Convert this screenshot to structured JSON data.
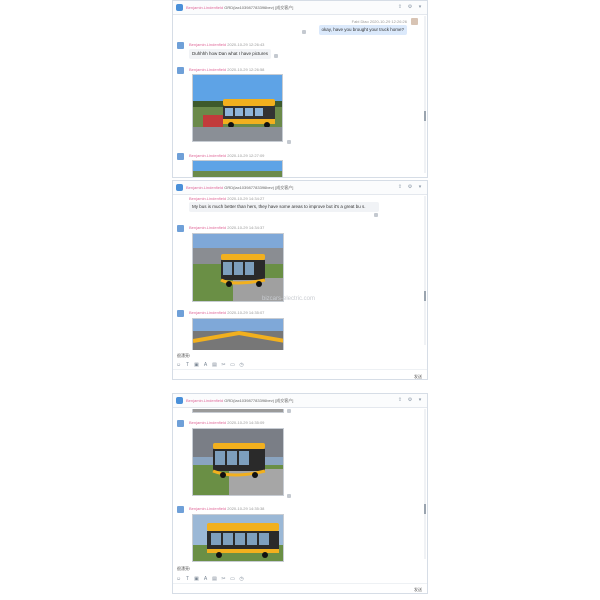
{
  "windows": [
    {
      "title_name": "Benjamin.Lindenfield",
      "title_rest": " GRD(lax103987783396bev) [成交客户]",
      "self_sender": "Fabi Diao  2020-10-29 12:26:26",
      "self_message": "okay, have you brought your truck home?",
      "messages": [
        {
          "sender_name": "Benjamin.Lindenfield",
          "time": " 2020-10-29 12:26:43",
          "text": "Duhhhh how Dan what I have pictures"
        },
        {
          "sender_name": "Benjamin.Lindenfield",
          "time": " 2020-10-29 12:26:58"
        },
        {
          "sender_name": "Benjamin.Lindenfield",
          "time": " 2020-10-29 12:27:09"
        }
      ]
    },
    {
      "title_name": "Benjamin.Lindenfield",
      "title_rest": " GRD(lax103987783396bev) [成交客户]",
      "messages": [
        {
          "sender_name": "Benjamin.Lindenfield",
          "time": " 2020-10-29 14:34:27",
          "text": "My bus is much better than hers, they have some areas to improve but it's a great bu s."
        },
        {
          "sender_name": "Benjamin.Lindenfield",
          "time": " 2020-10-29 14:34:37"
        },
        {
          "sender_name": "Benjamin.Lindenfield",
          "time": " 2020-10-29 14:35:07"
        }
      ],
      "typed": "很漂亮!",
      "send_label": "发送"
    },
    {
      "title_name": "Benjamin.Lindenfield",
      "title_rest": " GRD(lax103987783396bev) [成交客户]",
      "messages": [
        {
          "sender_name": "Benjamin.Lindenfield",
          "time": " 2020-10-29 14:35:09"
        },
        {
          "sender_name": "Benjamin.Lindenfield",
          "time": " 2020-10-29 14:35:38"
        }
      ],
      "typed": "很漂亮!",
      "send_label": "发送"
    }
  ],
  "watermark": "bizcars-electric.com",
  "toolbar_icons": [
    "emoji-icon",
    "text-icon",
    "image-icon",
    "font-icon",
    "file-icon",
    "screenshot-icon",
    "folder-icon",
    "history-icon"
  ],
  "colors": {
    "accent": "#4a90d9",
    "name_pink": "#e06a9a",
    "self_bubble": "#dbe9fb",
    "bus_yellow": "#f2b01e"
  }
}
